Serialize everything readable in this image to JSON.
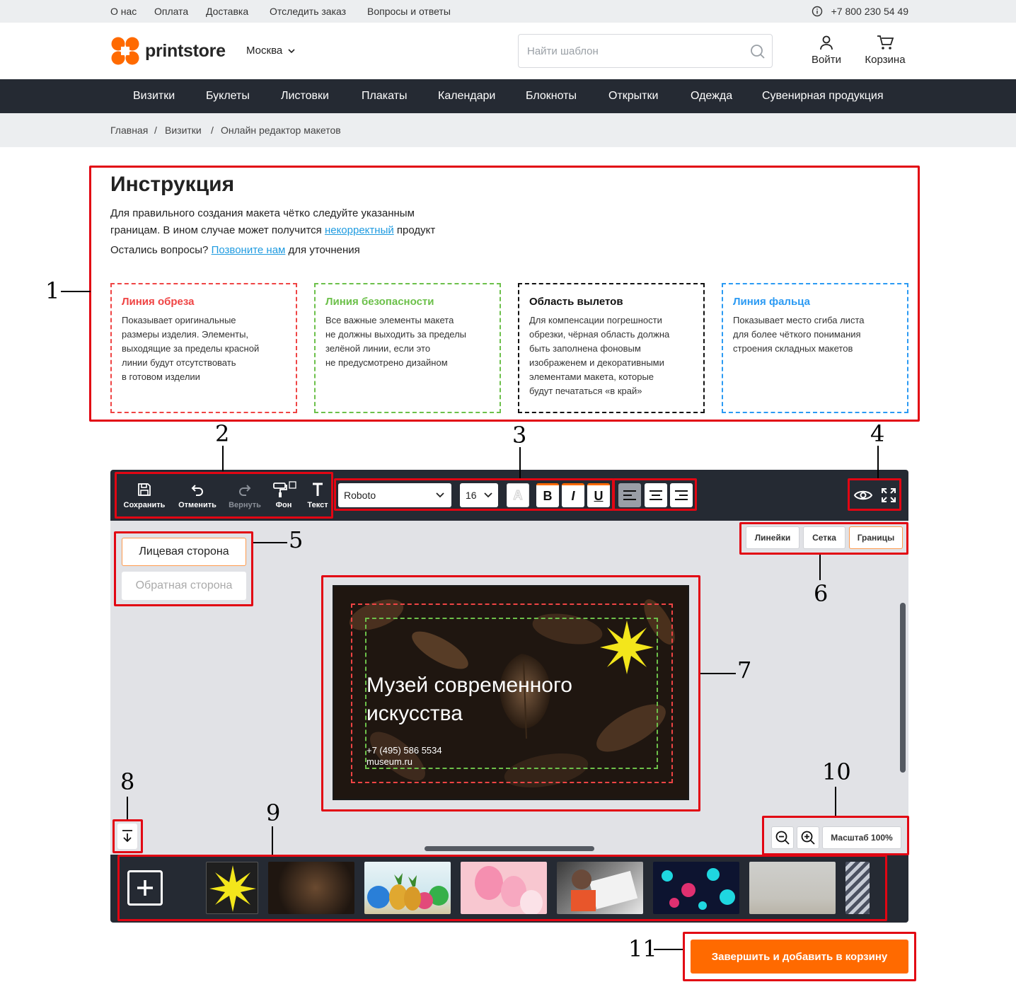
{
  "topbar": {
    "links": [
      "О нас",
      "Оплата",
      "Доставка",
      "Отследить заказ",
      "Вопросы и ответы"
    ],
    "phone": "+7 800 230 54 49"
  },
  "header": {
    "logo_text": "printstore",
    "city": "Москва",
    "search_placeholder": "Найти шаблон",
    "login": "Войти",
    "cart": "Корзина"
  },
  "nav": [
    "Визитки",
    "Буклеты",
    "Листовки",
    "Плакаты",
    "Календари",
    "Блокноты",
    "Открытки",
    "Одежда",
    "Сувенирная продукция"
  ],
  "breadcrumb": [
    "Главная",
    "/",
    "Визитки",
    "/",
    "Онлайн редактор макетов"
  ],
  "instruction": {
    "title": "Инструкция",
    "line1": "Для правильного создания макета чётко следуйте указанным",
    "line2_pre": "границам. В ином случае может получится ",
    "line2_link": "некорректный",
    "line2_post": " продукт",
    "line3_pre": "Остались вопросы? ",
    "line3_link": "Позвоните нам",
    "line3_post": " для уточнения",
    "cards": [
      {
        "title": "Линия обреза",
        "text": "Показывает оригинальные\nразмеры изделия. Элементы,\nвыходящие за пределы красной\nлинии будут отсутствовать\nв готовом изделии",
        "color": "#ef4444"
      },
      {
        "title": "Линия безопасности",
        "text": "Все важные элементы макета\nне должны выходить за пределы\nзелёной линии, если это\nне предусмотрено дизайном",
        "color": "#6cc04a"
      },
      {
        "title": "Область вылетов",
        "text": "Для компенсации погрешности\nобрезки, чёрная область должна\nбыть заполнена фоновым\nизображенем и декоративными\nэлементами макета, которые\nбудут печататься «в край»",
        "color": "#111111"
      },
      {
        "title": "Линия фальца",
        "text": "Показывает место сгиба листа\nдля более чёткого понимания\nстроения складных макетов",
        "color": "#2b9af3"
      }
    ]
  },
  "toolbar": {
    "save": "Сохранить",
    "undo": "Отменить",
    "redo": "Вернуть",
    "bg": "Фон",
    "text": "Текст",
    "font": "Roboto",
    "size": "16",
    "bold": "B",
    "italic": "I",
    "underline": "U",
    "color_letter": "A"
  },
  "view_toggles": {
    "rulers": "Линейки",
    "grid": "Сетка",
    "borders": "Границы"
  },
  "sides": {
    "front": "Лицевая сторона",
    "back": "Обратная сторона"
  },
  "card_design": {
    "title_line1": "Музей современного",
    "title_line2": "искусства",
    "phone": "+7 (495) 586 5534",
    "site": "museum.ru"
  },
  "zoom_label": "Масштаб 100%",
  "cta": "Завершить и добавить в корзину",
  "annotations": [
    "1",
    "2",
    "3",
    "4",
    "5",
    "6",
    "7",
    "8",
    "9",
    "10",
    "11"
  ],
  "colors": {
    "accent": "#ff6a00",
    "dark": "#252a33",
    "annotation": "#e20613",
    "link": "#1f9be0"
  }
}
